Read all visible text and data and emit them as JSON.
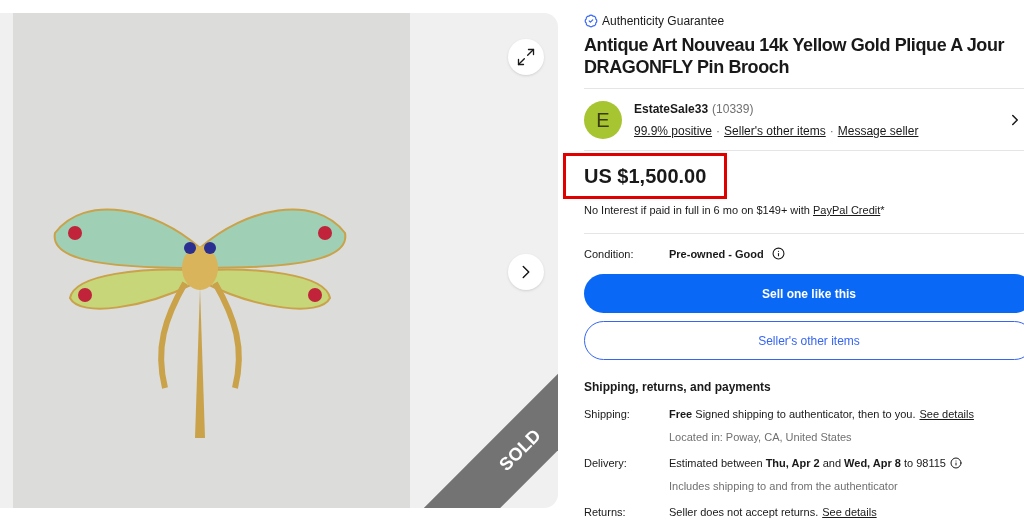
{
  "gallery": {
    "sold_label": "SOLD"
  },
  "listing": {
    "guarantee": "Authenticity Guarantee",
    "title": "Antique Art Nouveau 14k Yellow Gold Plique A Jour DRAGONFLY Pin Brooch"
  },
  "seller": {
    "initial": "E",
    "name": "EstateSale33",
    "count": "(10339)",
    "links": [
      "99.9% positive",
      "Seller's other items",
      "Message seller"
    ],
    "separator": "·"
  },
  "price": {
    "amount": "US $1,500.00",
    "financing": "No Interest if paid in full in 6 mo on $149+ with",
    "financing_link": "PayPal Credit",
    "financing_mark": "*"
  },
  "condition": {
    "label": "Condition:",
    "value": "Pre-owned - Good"
  },
  "buttons": [
    {
      "label": "Sell one like this",
      "kind": "primary"
    },
    {
      "label": "Seller's other items",
      "kind": "secondary"
    }
  ],
  "shipping": {
    "heading": "Shipping, returns, and payments",
    "rows": [
      {
        "label": "Shipping:",
        "text": "**Free** Signed shipping to authenticator, then to you.",
        "link": "See details",
        "note": "Located in: Poway, CA, United States",
        "info": false
      },
      {
        "label": "Delivery:",
        "text": "Estimated between **Thu, Apr 2** and **Wed, Apr 8** to 98115",
        "note": "Includes shipping to and from the authenticator",
        "info": true
      },
      {
        "label": "Returns:",
        "text": "Seller does not accept returns.",
        "link": "See details",
        "info": false
      }
    ]
  }
}
